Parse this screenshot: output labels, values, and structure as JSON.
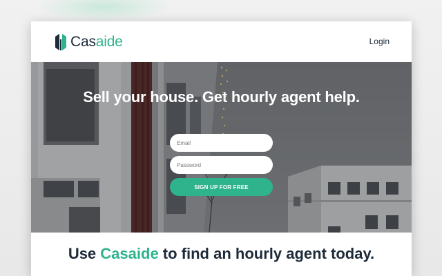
{
  "brand": {
    "name_part1": "Cas",
    "name_part2": "aide",
    "logo_icon": "building-icon",
    "accent_color": "#2fb38d",
    "text_color": "#1d2a38"
  },
  "nav": {
    "login_label": "Login"
  },
  "hero": {
    "headline": "Sell your house. Get hourly agent help.",
    "email_placeholder": "Email",
    "password_placeholder": "Password",
    "signup_label": "SIGN UP FOR FREE"
  },
  "tagline": {
    "prefix": "Use ",
    "brand": "Casaide",
    "suffix": " to find an hourly agent today."
  }
}
